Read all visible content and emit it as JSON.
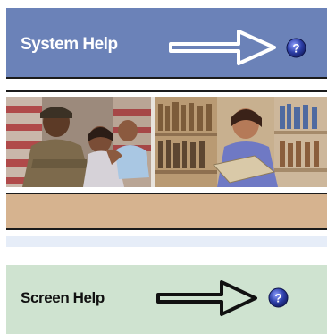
{
  "system_help": {
    "label": "System Help",
    "icon": "question-icon",
    "bar_color": "#6b82b8"
  },
  "photo_strip": {
    "left_photo_icon": "photo-soldier-family",
    "right_photo_icon": "photo-library-worker"
  },
  "screen_help": {
    "label": "Screen Help",
    "icon": "question-icon",
    "bar_color": "#cfe3d0"
  },
  "colors": {
    "tan_band": "#d6b38f",
    "stripe": "#e6edf8",
    "help_icon_blue": "#2d3fa8"
  }
}
